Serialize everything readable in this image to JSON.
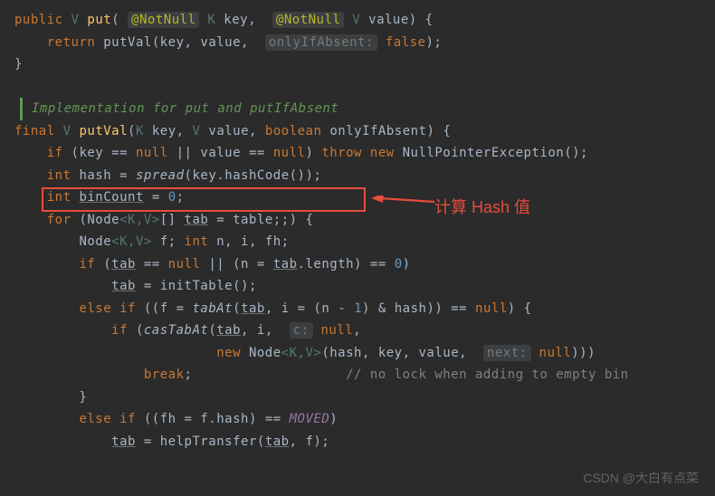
{
  "code": {
    "l1_public": "public",
    "l1_type": "V",
    "l1_put": "put",
    "l1_ann": "@NotNull",
    "l1_k": "K",
    "l1_key": "key",
    "l1_v": "V",
    "l1_value": "value",
    "l2_return": "return",
    "l2_putval": "putVal",
    "l2_args": "(key, value,",
    "l2_hint": "onlyIfAbsent:",
    "l2_false": "false",
    "doc": "Implementation for put and putIfAbsent",
    "l3_final": "final",
    "l3_v": "V",
    "l3_putval": "putVal",
    "l3_k": "K",
    "l3_key": "key",
    "l3_vt": "V",
    "l3_value": "value",
    "l3_bool": "boolean",
    "l3_only": "onlyIfAbsent",
    "l4_if": "if",
    "l4_cond": "(key == ",
    "l4_null1": "null",
    "l4_mid": " || value == ",
    "l4_null2": "null",
    "l4_throw": "throw new",
    "l4_exc": "NullPointerException",
    "l5_int": "int",
    "l5_hash": "hash = ",
    "l5_spread": "spread",
    "l5_args": "(key.hashCode());",
    "l6_int": "int",
    "l6_bin": "binCount",
    "l6_eq": " = ",
    "l6_zero": "0",
    "l7_for": "for",
    "l7_node": "Node",
    "l7_gen": "<K,V>",
    "l7_arr": "[] ",
    "l7_tab": "tab",
    "l7_rest": " = table;;) {",
    "l8_node": "Node",
    "l8_gen": "<K,V>",
    "l8_vars": " f; ",
    "l8_int": "int",
    "l8_rest": " n, i, fh;",
    "l9_if": "if",
    "l9_open": " (",
    "l9_tab1": "tab",
    "l9_mid": " == ",
    "l9_null": "null",
    "l9_or": " || (n = ",
    "l9_tab2": "tab",
    "l9_len": ".length) == ",
    "l9_zero": "0",
    "l10_tab": "tab",
    "l10_rest": " = initTable();",
    "l11_else": "else if",
    "l11_open": " ((f = ",
    "l11_tabat": "tabAt",
    "l11_op2": "(",
    "l11_tab": "tab",
    "l11_mid": ", i = (n - ",
    "l11_one": "1",
    "l11_and": ") & hash)) == ",
    "l11_null": "null",
    "l12_if": "if",
    "l12_open": " (",
    "l12_cas": "casTabAt",
    "l12_op2": "(",
    "l12_tab": "tab",
    "l12_args": ", i, ",
    "l12_hint": "c:",
    "l12_null": "null",
    "l13_new": "new",
    "l13_node": "Node",
    "l13_gen": "<K,V>",
    "l13_args": "(hash, key, value, ",
    "l13_hint": "next:",
    "l13_null": "null",
    "l14_break": "break",
    "l14_comment": "// no lock when adding to empty bin",
    "l16_else": "else if",
    "l16_cond": " ((fh = f.hash) == ",
    "l16_moved": "MOVED",
    "l17_tab": "tab",
    "l17_help": " = helpTransfer(",
    "l17_tab2": "tab",
    "l17_rest": ", f);"
  },
  "annotation": {
    "label": "计算 Hash 值"
  },
  "watermark": "CSDN @大白有点菜"
}
